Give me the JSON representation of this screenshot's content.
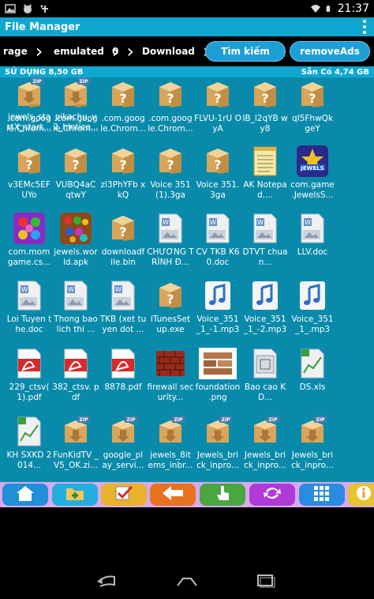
{
  "status_bar": {
    "time": "21:37"
  },
  "app": {
    "title": "File Manager"
  },
  "path": {
    "crumbs": [
      "rage",
      "emulated",
      "0",
      "Download"
    ],
    "search_label": "Tìm kiếm",
    "remove_ads_label": "removeAds"
  },
  "storage": {
    "used": "SỬ DỤNG 8,50 GB",
    "free": "Sẵn Có 4,74 GB"
  },
  "files": [
    {
      "name": ".com.goog le.Chrom...",
      "icon": "unknown-file"
    },
    {
      "name": ".com.goog le.Chrom...",
      "icon": "unknown-file"
    },
    {
      "name": ".com.goog le.Chrom...",
      "icon": "unknown-file"
    },
    {
      "name": ".com.goog le.Chrom...",
      "icon": "unknown-file"
    },
    {
      "name": "FLVU-1rU OyA",
      "icon": "unknown-file"
    },
    {
      "name": "IB_l2qYB wy8",
      "icon": "unknown-file"
    },
    {
      "name": "qI5FhwQk geY",
      "icon": "unknown-file"
    },
    {
      "name": "v3EMc5EF UYo",
      "icon": "unknown-file"
    },
    {
      "name": "VUBQ4aC qtwY",
      "icon": "unknown-file"
    },
    {
      "name": "zl3PhYFb xkQ",
      "icon": "unknown-file"
    },
    {
      "name": "Voice 351 (1).3ga",
      "icon": "unknown-file"
    },
    {
      "name": "Voice 351.3ga",
      "icon": "unknown-file"
    },
    {
      "name": "AK Notepad....",
      "icon": "notepad"
    },
    {
      "name": "com.game .JewelsS...",
      "icon": "jewels-star"
    },
    {
      "name": "com.mom game.cs...",
      "icon": "candy-game"
    },
    {
      "name": "jewels.wor ld.apk",
      "icon": "jewels-world"
    },
    {
      "name": "downloadf ile.bin",
      "icon": "unknown-file"
    },
    {
      "name": "CHƯƠNG TRÌNH Đ...",
      "icon": "doc-file"
    },
    {
      "name": "CV TKB K60.doc",
      "icon": "doc-file"
    },
    {
      "name": "DTVT chuan...",
      "icon": "doc-file"
    },
    {
      "name": "LLV.doc",
      "icon": "doc-file"
    },
    {
      "name": "Loi Tuyen the.doc",
      "icon": "doc-file"
    },
    {
      "name": "Thong bao lich thi ...",
      "icon": "doc-file"
    },
    {
      "name": "TKB (xet tuyen dot ...",
      "icon": "doc-file"
    },
    {
      "name": "iTunesSet up.exe",
      "icon": "unknown-file"
    },
    {
      "name": "Voice_351 _1_-1.mp3",
      "icon": "music-file"
    },
    {
      "name": "Voice_351 _1_-2.mp3",
      "icon": "music-file"
    },
    {
      "name": "Voice_351 _1_.mp3",
      "icon": "music-file"
    },
    {
      "name": "229_ctsv( 1).pdf",
      "icon": "pdf-file"
    },
    {
      "name": "382_ctsv. pdf",
      "icon": "pdf-file"
    },
    {
      "name": "8878.pdf",
      "icon": "pdf-file"
    },
    {
      "name": "firewall security...",
      "icon": "firewall"
    },
    {
      "name": "foundation .png",
      "icon": "bricks-image"
    },
    {
      "name": "Bao cao KD...",
      "icon": "xls-file"
    },
    {
      "name": "DS.xls",
      "icon": "xls-chart-file"
    },
    {
      "name": "KH SXKD 2014...",
      "icon": "xls-chart-file"
    },
    {
      "name": "FunKidTV _V5_OK.zi...",
      "icon": "zip-file"
    },
    {
      "name": "google_pl ay_servi...",
      "icon": "zip-file"
    },
    {
      "name": "jewels_8it ems_inbr...",
      "icon": "zip-file"
    },
    {
      "name": "Jewels_bri ck_inpro...",
      "icon": "zip-file"
    },
    {
      "name": "Jewels_bri ck_inpro...",
      "icon": "zip-file"
    },
    {
      "name": "Jewels_bri ck_inpro...",
      "icon": "zip-file"
    },
    {
      "name": "jewels_sta rtX_start...",
      "icon": "zip-file"
    },
    {
      "name": "pikachu_v 2_hintico...",
      "icon": "zip-file"
    }
  ],
  "toolbar": [
    {
      "name": "home",
      "icon": "home-icon",
      "bg": "#1f8fd8"
    },
    {
      "name": "new-folder",
      "icon": "add-folder-icon",
      "bg": "#22aede"
    },
    {
      "name": "select",
      "icon": "checkmark-icon",
      "bg": "#e8b32b"
    },
    {
      "name": "back",
      "icon": "left-arrow-icon",
      "bg": "#e8731f"
    },
    {
      "name": "touch",
      "icon": "hand-pointer-icon",
      "bg": "#4aa640"
    },
    {
      "name": "refresh",
      "icon": "refresh-icon",
      "bg": "#b03ad6"
    },
    {
      "name": "grid-view",
      "icon": "grid-icon",
      "bg": "#2a8ce0"
    },
    {
      "name": "info",
      "icon": "info-icon",
      "bg": "#e8c32b"
    }
  ],
  "nav": [
    "back-nav-icon",
    "home-nav-icon",
    "recents-nav-icon"
  ]
}
